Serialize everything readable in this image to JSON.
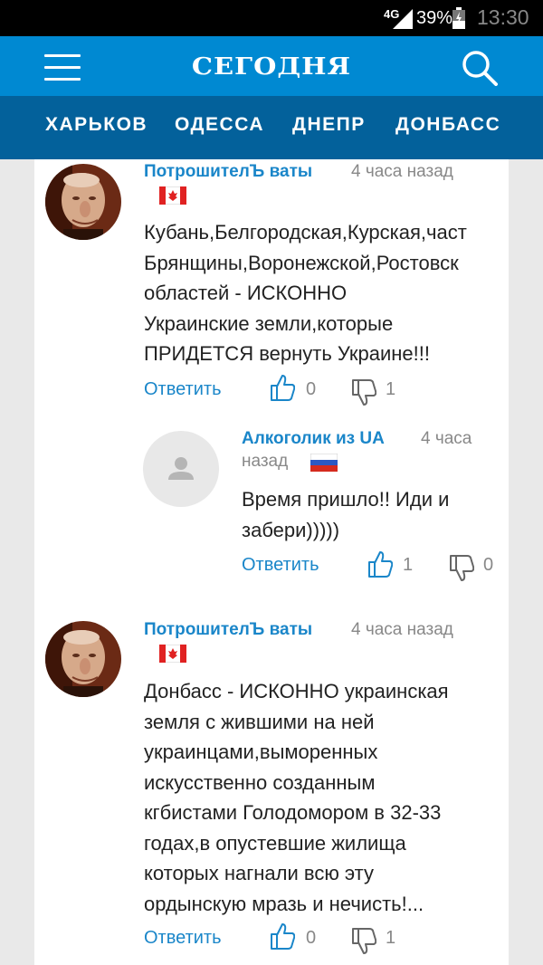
{
  "status": {
    "network": "4G",
    "battery": "39%",
    "time": "13:30"
  },
  "app": {
    "logo": "СЕГОДНЯ"
  },
  "nav": {
    "items": [
      "ХАРЬКОВ",
      "ОДЕССА",
      "ДНЕПР",
      "ДОНБАСС"
    ]
  },
  "comments": [
    {
      "author": "ПотрошителЪ ваты",
      "time": "4 часа назад",
      "text_lines": [
        "Кубань,Белгородская,Курская,част",
        "Брянщины,Воронежской,Ростовск",
        "областей - ИСКОННО",
        "Украинские земли,которые",
        "ПРИДЕТСЯ вернуть Украине!!!"
      ],
      "reply": "Ответить",
      "likes": "0",
      "dislikes": "1"
    },
    {
      "author": "Алкоголик из UA",
      "time_part1": "4 часа",
      "time_part2": "назад",
      "text_lines": [
        "Время пришло!! Иди и",
        "забери)))))"
      ],
      "reply": "Ответить",
      "likes": "1",
      "dislikes": "0"
    },
    {
      "author": "ПотрошителЪ ваты",
      "time": "4 часа назад",
      "text_lines": [
        "Донбасс - ИСКОННО украинская",
        "земля с жившими на ней",
        "украинцами,выморенных",
        "искусственно созданным",
        "кгбистами Голодомором в 32-33",
        "годах,в опустевшие жилища",
        "которых нагнали всю эту",
        "ордынскую мразь и нечисть!..."
      ],
      "reply": "Ответить",
      "likes": "0",
      "dislikes": "1"
    }
  ],
  "colors": {
    "appbar": "#0089d2",
    "navbar": "#03619b",
    "link": "#1a86c9"
  },
  "icons": {
    "menu": "menu-icon",
    "search": "search-icon",
    "like": "thumbs-up-icon",
    "dislike": "thumbs-down-icon"
  }
}
